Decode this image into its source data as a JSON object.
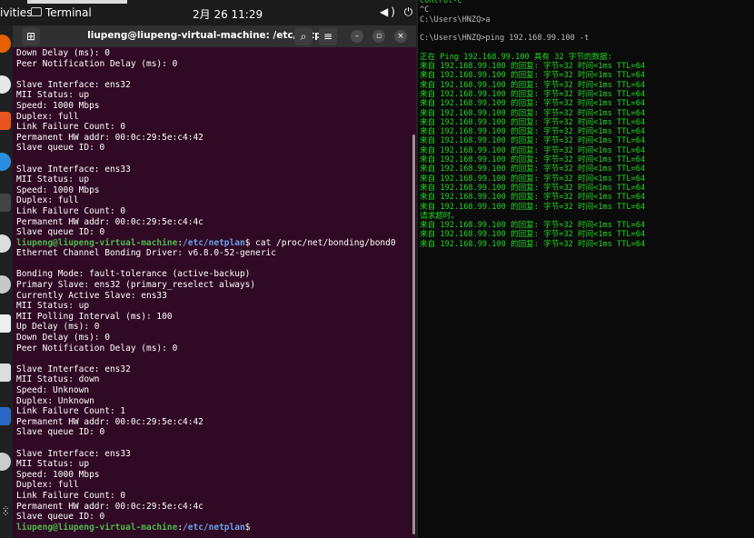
{
  "topbar": {
    "activities": "ivities",
    "app_name": "Terminal",
    "datetime": "2月 26  11:29",
    "tray": "◀) ⏻"
  },
  "terminal": {
    "title": "liupeng@liupeng-virtual-machine: /etc/netplan",
    "prompt_user": "liupeng@liupeng-virtual-machine",
    "prompt_path": "/etc/netplan",
    "lines_a": [
      "Down Delay (ms): 0",
      "Peer Notification Delay (ms): 0",
      "",
      "Slave Interface: ens32",
      "MII Status: up",
      "Speed: 1000 Mbps",
      "Duplex: full",
      "Link Failure Count: 0",
      "Permanent HW addr: 00:0c:29:5e:c4:42",
      "Slave queue ID: 0",
      "",
      "Slave Interface: ens33",
      "MII Status: up",
      "Speed: 1000 Mbps",
      "Duplex: full",
      "Link Failure Count: 0",
      "Permanent HW addr: 00:0c:29:5e:c4:4c",
      "Slave queue ID: 0"
    ],
    "command": " cat /proc/net/bonding/bond0",
    "lines_b": [
      "Ethernet Channel Bonding Driver: v6.8.0-52-generic",
      "",
      "Bonding Mode: fault-tolerance (active-backup)",
      "Primary Slave: ens32 (primary_reselect always)",
      "Currently Active Slave: ens33",
      "MII Status: up",
      "MII Polling Interval (ms): 100",
      "Up Delay (ms): 0",
      "Down Delay (ms): 0",
      "Peer Notification Delay (ms): 0",
      "",
      "Slave Interface: ens32",
      "MII Status: down",
      "Speed: Unknown",
      "Duplex: Unknown",
      "Link Failure Count: 1",
      "Permanent HW addr: 00:0c:29:5e:c4:42",
      "Slave queue ID: 0",
      "",
      "Slave Interface: ens33",
      "MII Status: up",
      "Speed: 1000 Mbps",
      "Duplex: full",
      "Link Failure Count: 0",
      "Permanent HW addr: 00:0c:29:5e:c4:4c",
      "Slave queue ID: 0"
    ]
  },
  "cmd": {
    "header_lines": [
      "Control-C",
      "^C",
      "C:\\Users\\HNZQ>a",
      "",
      "C:\\Users\\HNZQ>ping 192.168.99.100 -t",
      ""
    ],
    "ping_header": "正在 Ping 192.168.99.100 具有 32 字节的数据:",
    "reply_line": "来自 192.168.99.100 的回复: 字节=32 时间<1ms TTL=64",
    "timeout_line": "请求超时。",
    "replies_before": 16,
    "replies_after": 3
  },
  "colors": {
    "terminal_bg": "#300a24",
    "prompt_user": "#4fb74f",
    "prompt_path": "#6aa0e8",
    "cmd_text": "#1fd81f"
  }
}
